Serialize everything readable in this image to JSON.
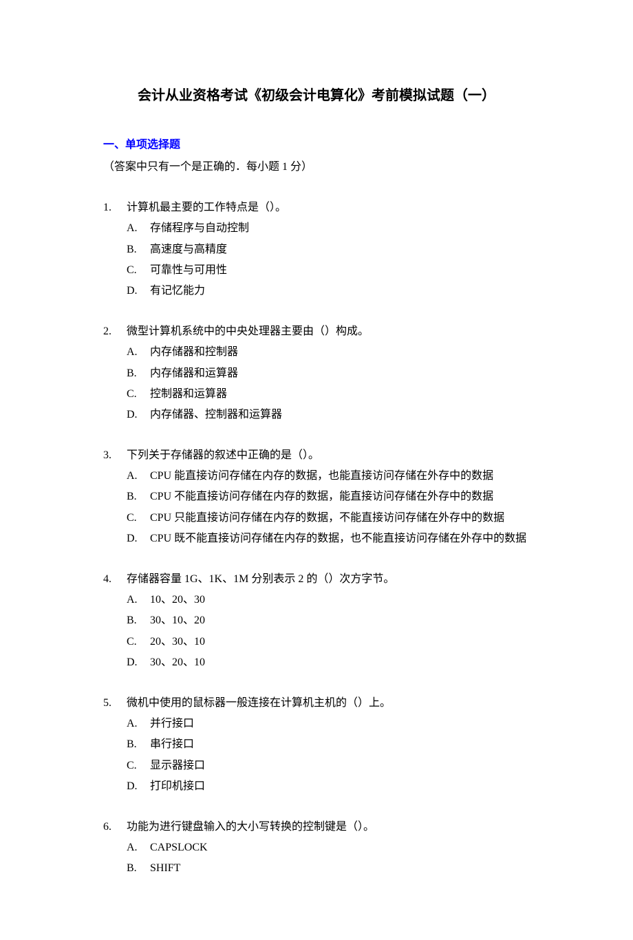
{
  "title": "会计从业资格考试《初级会计电算化》考前模拟试题（一）",
  "section_header": "一、单项选择题",
  "section_note": "（答案中只有一个是正确的．每小题 1 分）",
  "questions": [
    {
      "number": "1.",
      "stem": "计算机最主要的工作特点是（）。",
      "options": [
        {
          "letter": "A.",
          "text": "存储程序与自动控制"
        },
        {
          "letter": "B.",
          "text": "高速度与高精度"
        },
        {
          "letter": "C.",
          "text": "可靠性与可用性"
        },
        {
          "letter": "D.",
          "text": "有记忆能力"
        }
      ]
    },
    {
      "number": "2.",
      "stem": "微型计算机系统中的中央处理器主要由（）构成。",
      "options": [
        {
          "letter": "A.",
          "text": "内存储器和控制器"
        },
        {
          "letter": "B.",
          "text": "内存储器和运算器"
        },
        {
          "letter": "C.",
          "text": "控制器和运算器"
        },
        {
          "letter": "D.",
          "text": "内存储器、控制器和运算器"
        }
      ]
    },
    {
      "number": "3.",
      "stem": "下列关于存储器的叙述中正确的是（）。",
      "options": [
        {
          "letter": "A.",
          "text": "CPU 能直接访问存储在内存的数据，也能直接访问存储在外存中的数据"
        },
        {
          "letter": "B.",
          "text": "CPU 不能直接访问存储在内存的数据，能直接访问存储在外存中的数据"
        },
        {
          "letter": "C.",
          "text": "CPU 只能直接访问存储在内存的数据，不能直接访问存储在外存中的数据"
        },
        {
          "letter": "D.",
          "text": "CPU 既不能直接访问存储在内存的数据，也不能直接访问存储在外存中的数据"
        }
      ]
    },
    {
      "number": "4.",
      "stem": "存储器容量 1G、1K、1M 分别表示 2 的（）次方字节。",
      "options": [
        {
          "letter": "A.",
          "text": "10、20、30"
        },
        {
          "letter": "B.",
          "text": "30、10、20"
        },
        {
          "letter": "C.",
          "text": "20、30、10"
        },
        {
          "letter": "D.",
          "text": "30、20、10"
        }
      ]
    },
    {
      "number": "5.",
      "stem": "微机中使用的鼠标器一般连接在计算机主机的（）上。",
      "options": [
        {
          "letter": "A.",
          "text": "并行接口"
        },
        {
          "letter": "B.",
          "text": "串行接口"
        },
        {
          "letter": "C.",
          "text": "显示器接口"
        },
        {
          "letter": "D.",
          "text": "打印机接口"
        }
      ]
    },
    {
      "number": "6.",
      "stem": "功能为进行键盘输入的大小写转换的控制键是（）。",
      "options": [
        {
          "letter": "A.",
          "text": "CAPSLOCK"
        },
        {
          "letter": "B.",
          "text": "SHIFT"
        }
      ]
    }
  ]
}
